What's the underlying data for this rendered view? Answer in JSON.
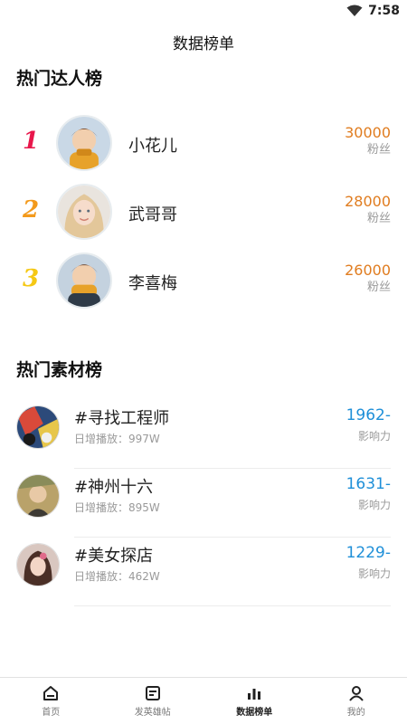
{
  "status": {
    "time": "7:58"
  },
  "header": {
    "title": "数据榜单"
  },
  "kol_section": {
    "title": "热门达人榜",
    "items": [
      {
        "rank": "1",
        "rank_color": "#e8174b",
        "name": "小花儿",
        "fans": "30000",
        "fans_label": "粉丝"
      },
      {
        "rank": "2",
        "rank_color": "#f39a1c",
        "name": "武哥哥",
        "fans": "28000",
        "fans_label": "粉丝"
      },
      {
        "rank": "3",
        "rank_color": "#f5c814",
        "name": "李喜梅",
        "fans": "26000",
        "fans_label": "粉丝"
      }
    ]
  },
  "material_section": {
    "title": "热门素材榜",
    "items": [
      {
        "title": "#寻找工程师",
        "sub": "日增播放：997W",
        "stat": "1962-",
        "stat_label": "影响力"
      },
      {
        "title": "#神州十六",
        "sub": "日增播放：895W",
        "stat": "1631-",
        "stat_label": "影响力"
      },
      {
        "title": "#美女探店",
        "sub": "日增播放：462W",
        "stat": "1229-",
        "stat_label": "影响力"
      }
    ]
  },
  "tabbar": {
    "items": [
      {
        "label": "首页",
        "icon": "home-icon"
      },
      {
        "label": "发英雄帖",
        "icon": "post-icon"
      },
      {
        "label": "数据榜单",
        "icon": "chart-icon",
        "active": true
      },
      {
        "label": "我的",
        "icon": "user-icon"
      }
    ]
  },
  "colors": {
    "fans": "#e07c1f",
    "stat": "#1e8fd8",
    "rank1": "#e8174b",
    "rank2": "#f39a1c",
    "rank3": "#f5c814"
  }
}
